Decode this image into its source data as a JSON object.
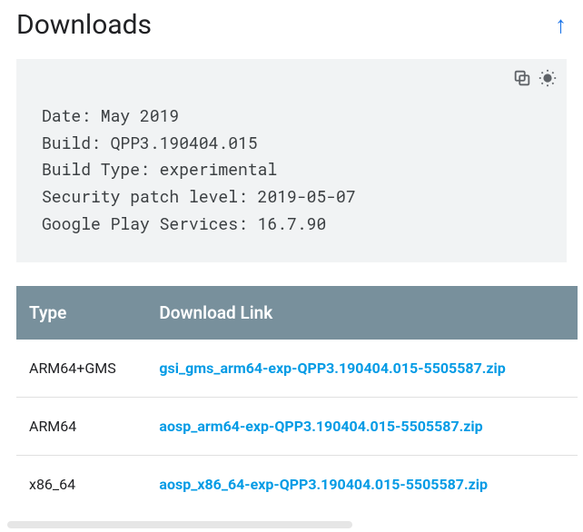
{
  "header": {
    "title": "Downloads"
  },
  "code": {
    "lines": [
      "Date: May 2019",
      "Build: QPP3.190404.015",
      "Build Type: experimental",
      "Security patch level: 2019-05-07",
      "Google Play Services: 16.7.90"
    ]
  },
  "table": {
    "columns": [
      "Type",
      "Download Link"
    ],
    "rows": [
      {
        "type": "ARM64+GMS",
        "link": "gsi_gms_arm64-exp-QPP3.190404.015-5505587.zip"
      },
      {
        "type": "ARM64",
        "link": "aosp_arm64-exp-QPP3.190404.015-5505587.zip"
      },
      {
        "type": "x86_64",
        "link": "aosp_x86_64-exp-QPP3.190404.015-5505587.zip"
      }
    ]
  }
}
